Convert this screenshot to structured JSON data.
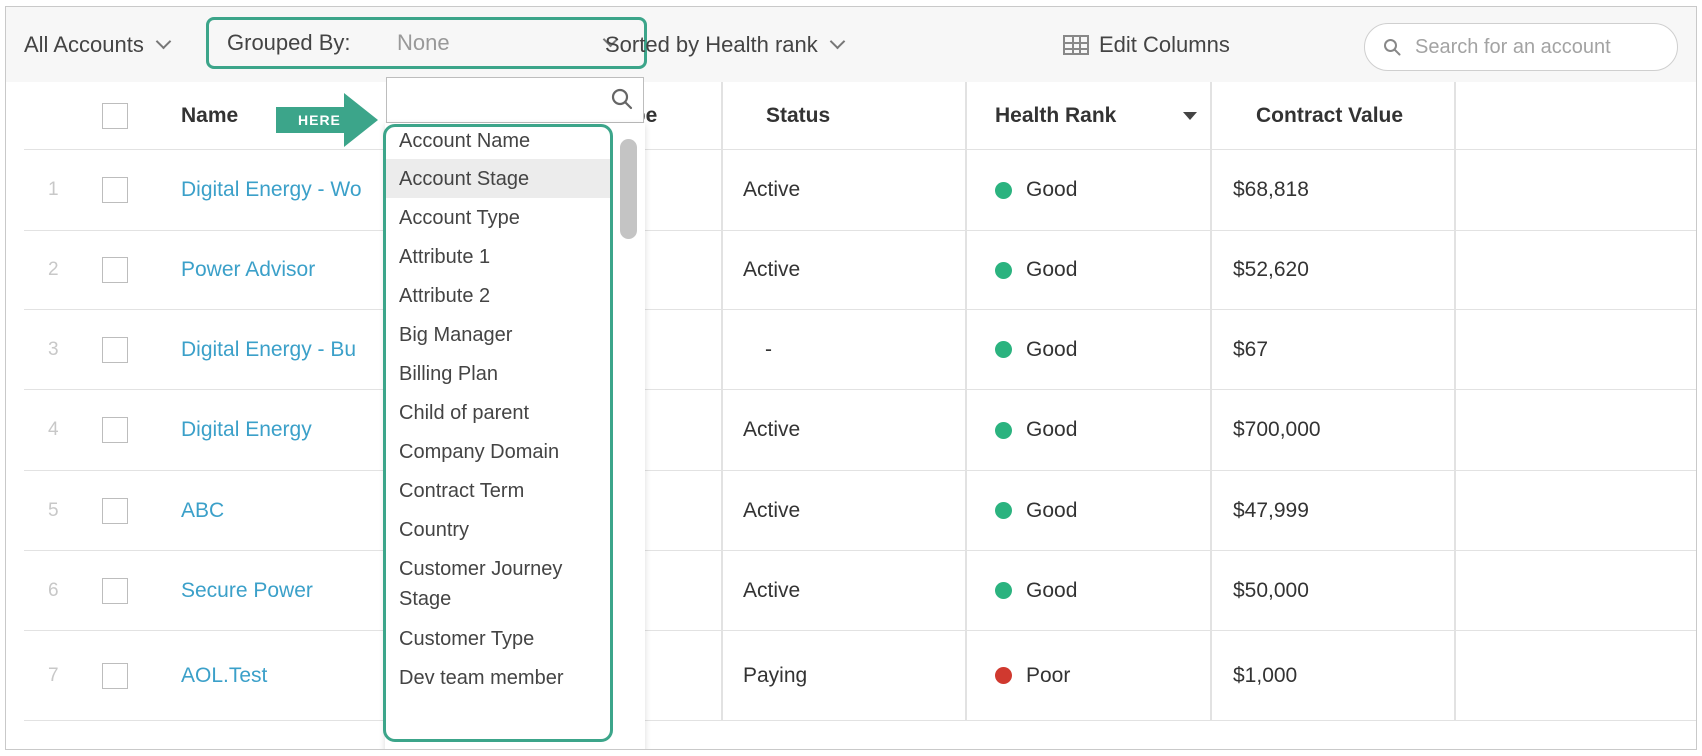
{
  "toolbar": {
    "account_filter": "All Accounts",
    "grouped_by_label": "Grouped By:",
    "grouped_by_value": "None",
    "sort_label": "Sorted by Health rank",
    "edit_columns": "Edit Columns",
    "search_placeholder": "Search for an account"
  },
  "callout": {
    "text": "HERE"
  },
  "table": {
    "headers": {
      "name": "Name",
      "account_type": "t Type",
      "status": "Status",
      "health_rank": "Health Rank",
      "contract_value": "Contract Value"
    },
    "rows": [
      {
        "num": "1",
        "name": "Digital Energy - Wo",
        "type_btn": "...",
        "status": "Active",
        "health": "Good",
        "value": "$68,818"
      },
      {
        "num": "2",
        "name": "Power Advisor",
        "type_btn": "...",
        "status": "Active",
        "health": "Good",
        "value": "$52,620"
      },
      {
        "num": "3",
        "name": "Digital Energy - Bu",
        "type_btn": "...",
        "status": "-",
        "health": "Good",
        "value": "$67"
      },
      {
        "num": "4",
        "name": "Digital Energy",
        "type_btn": "",
        "status": "Active",
        "health": "Good",
        "value": "$700,000"
      },
      {
        "num": "5",
        "name": "ABC",
        "type_btn": "...",
        "status": "Active",
        "health": "Good",
        "value": "$47,999"
      },
      {
        "num": "6",
        "name": "Secure Power",
        "type_btn": "",
        "status": "Active",
        "health": "Good",
        "value": "$50,000"
      },
      {
        "num": "7",
        "name": "AOL.Test",
        "type_btn": "...",
        "status": "Paying",
        "health": "Poor",
        "value": "$1,000"
      }
    ]
  },
  "dropdown": {
    "search_value": "",
    "items": [
      "Account Name",
      "Account Stage",
      "Account Type",
      "Attribute 1",
      "Attribute 2",
      "Big Manager",
      "Billing Plan",
      "Child of parent",
      "Company Domain",
      "Contract Term",
      "Country",
      "Customer Journey Stage",
      "Customer Type",
      "Dev team member"
    ],
    "active_index": 1
  },
  "colors": {
    "accent_green": "#3ca58a",
    "link_blue": "#3ba0c9",
    "good": "#2bb37f",
    "poor": "#d0392f"
  }
}
